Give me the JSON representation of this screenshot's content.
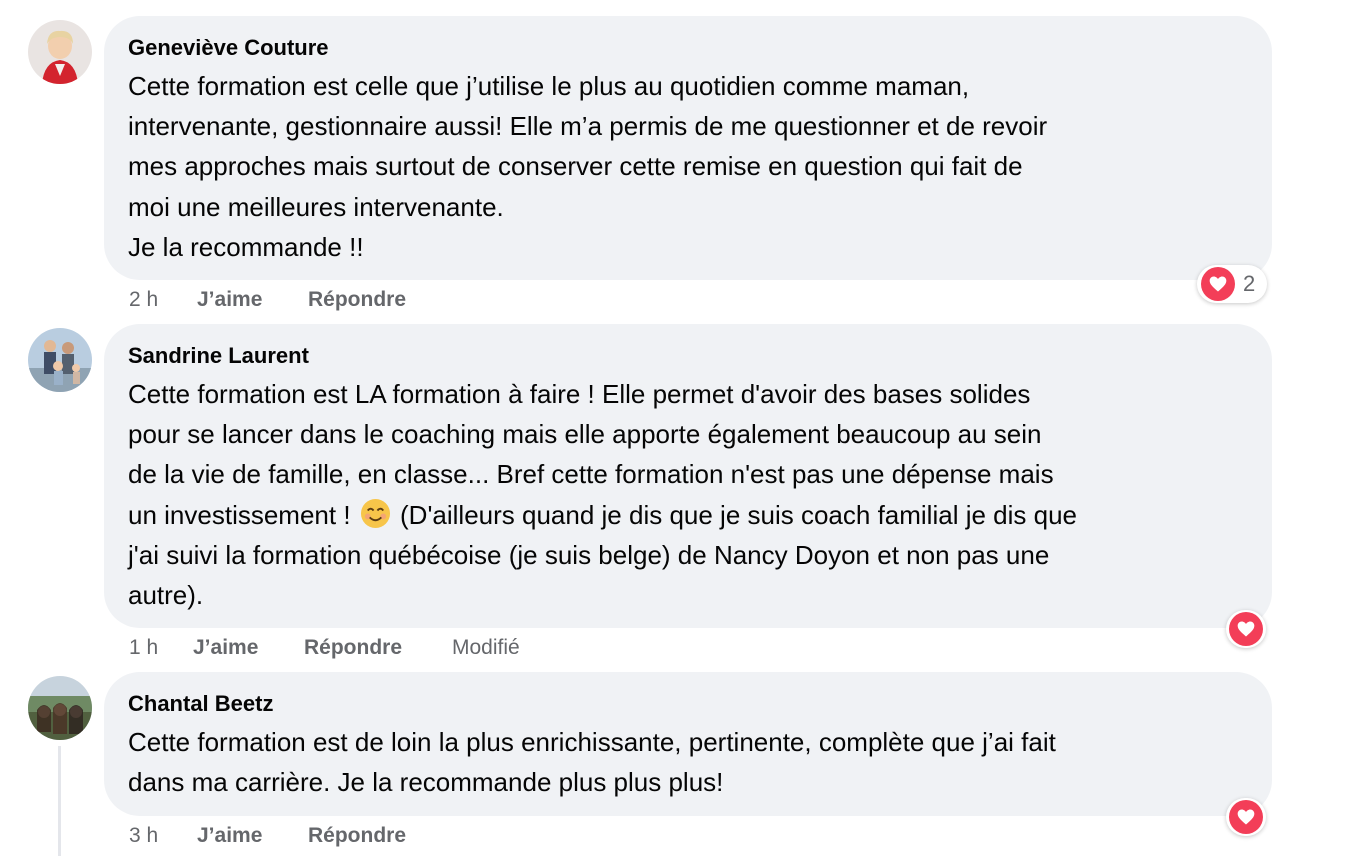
{
  "comments": [
    {
      "author": "Geneviève Couture",
      "text": "Cette formation est celle que j’utilise le plus au quotidien comme maman,\nintervenante, gestionnaire aussi! Elle m’a permis de me questionner et de revoir\nmes approches mais surtout de conserver cette remise en question qui fait de\nmoi une meilleures intervenante.\nJe la recommande !!",
      "time": "2 h",
      "like_label": "J’aime",
      "reply_label": "Répondre",
      "reaction": "heart-icon",
      "reaction_count": "2"
    },
    {
      "author": "Sandrine Laurent",
      "text_before_emoji": "Cette formation est LA formation à faire ! Elle permet d'avoir des bases solides\npour se lancer dans le coaching mais elle apporte également beaucoup au sein\nde la vie de famille, en classe... Bref cette formation n'est pas une dépense mais\nun investissement ! ",
      "emoji": "smiling-face-emoji",
      "text_after_emoji": " (D'ailleurs quand je dis que je suis coach familial je dis que\nj'ai suivi la formation québécoise (je suis belge) de Nancy Doyon et non pas une\nautre).",
      "time": "1 h",
      "like_label": "J’aime",
      "reply_label": "Répondre",
      "edited_label": "Modifié",
      "reaction": "heart-icon"
    },
    {
      "author": "Chantal Beetz",
      "text": "Cette formation est de loin la plus enrichissante, pertinente, complète que j’ai fait\ndans ma carrière. Je la recommande plus plus plus!",
      "time": "3 h",
      "like_label": "J’aime",
      "reply_label": "Répondre",
      "reaction": "heart-icon"
    }
  ],
  "colors": {
    "bubble": "#f0f2f5",
    "meta": "#65676b",
    "heart": "#f33e58"
  }
}
